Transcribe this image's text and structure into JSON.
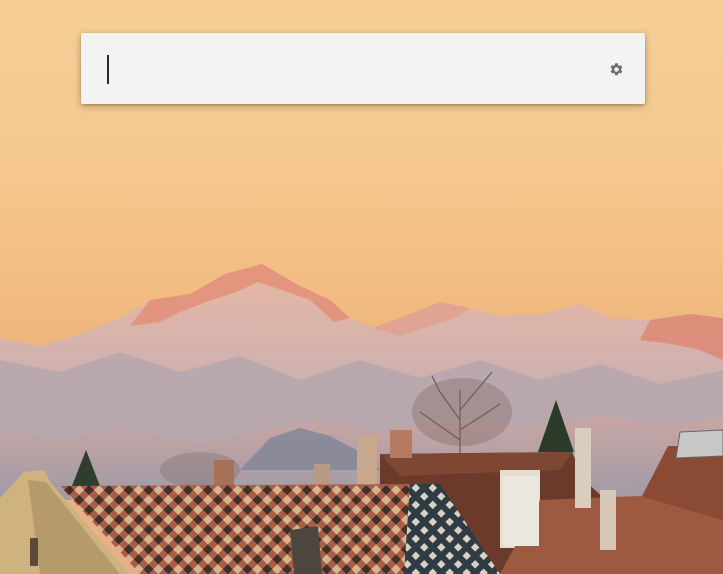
{
  "search": {
    "value": "",
    "placeholder": ""
  },
  "icons": {
    "settings": "gear-icon"
  },
  "colors": {
    "panel_background": "#f3f3f3",
    "gear": "#6e6e6e",
    "sky_top": "#f6cf97",
    "sky_horizon": "#eeb47c"
  }
}
